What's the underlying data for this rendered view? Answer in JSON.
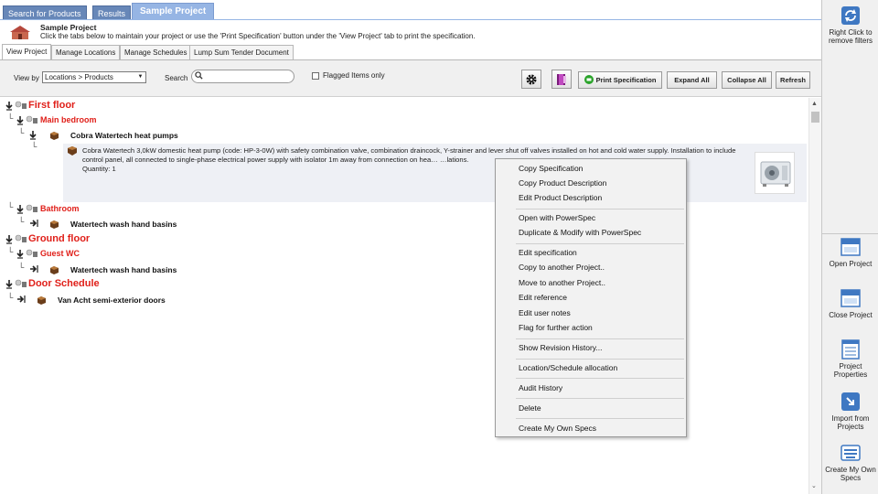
{
  "top_tabs": [
    {
      "label": "Search for Products"
    },
    {
      "label": "Results"
    },
    {
      "label": "Sample Project"
    }
  ],
  "header": {
    "title": "Sample Project",
    "description": "Click the tabs below to maintain your project or use the 'Print Specification' button under the 'View Project' tab to print the specification."
  },
  "sub_tabs": [
    {
      "label": "View Project"
    },
    {
      "label": "Manage Locations"
    },
    {
      "label": "Manage Schedules"
    },
    {
      "label": "Lump Sum Tender Document"
    }
  ],
  "toolbar": {
    "view_by_label": "View by",
    "view_by_value": "Locations > Products",
    "search_label": "Search",
    "search_value": "",
    "flagged_label": "Flagged Items only",
    "print_label": "Print Specification",
    "expand_label": "Expand All",
    "collapse_label": "Collapse All",
    "refresh_label": "Refresh"
  },
  "tree": {
    "first_floor": "First floor",
    "main_bedroom": "Main bedroom",
    "product_heat_pumps": "Cobra Watertech heat pumps",
    "detail_text": "Cobra Watertech 3,0kW domestic heat pump (code: HP-3-0W) with safety combination valve, combination draincock, Y-strainer and lever shut off valves installed on hot and cold water supply. Installation to include control panel, all connected to single-phase electrical power supply with isolator 1m away from connection on hea… …lations.",
    "detail_qty": "Quantity: 1",
    "bathroom": "Bathroom",
    "product_wash_basins_1": "Watertech wash hand basins",
    "ground_floor": "Ground floor",
    "guest_wc": "Guest WC",
    "product_wash_basins_2": "Watertech wash hand basins",
    "door_schedule": "Door Schedule",
    "product_doors": "Van Acht semi-exterior doors"
  },
  "context_menu": [
    "Copy Specification",
    "Copy Product Description",
    "Edit Product Description",
    "Open with PowerSpec",
    "Duplicate & Modify with PowerSpec",
    "Edit specification",
    "Copy to another Project..",
    "Move to another Project..",
    "Edit reference",
    "Edit user notes",
    "Flag for further action",
    "Show Revision History...",
    "Location/Schedule allocation",
    "Audit History",
    "Delete",
    "Create My Own Specs"
  ],
  "sidebar": {
    "remove_filters": "Right Click to remove filters",
    "open_project": "Open Project",
    "close_project": "Close Project",
    "project_properties": "Project Properties",
    "import_projects": "Import from Projects",
    "create_specs": "Create My Own Specs"
  },
  "colors": {
    "tab_blue": "#6787b8",
    "tab_active": "#96b5e4",
    "location_red": "#e0201a"
  }
}
